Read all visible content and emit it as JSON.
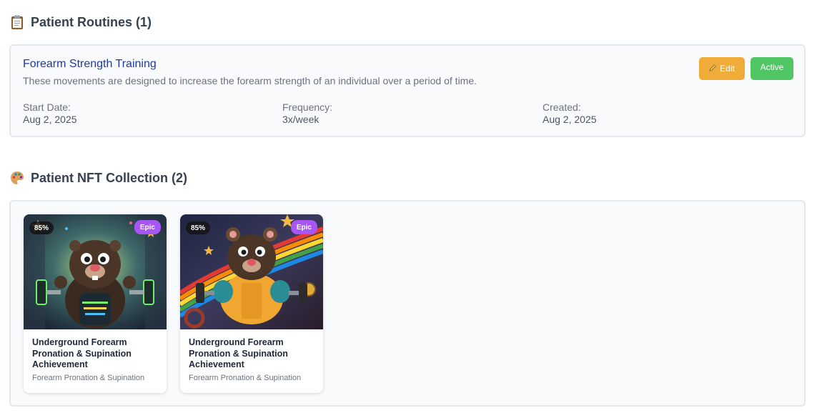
{
  "routines": {
    "section_title": "Patient Routines (1)",
    "section_icon": "clipboard-icon",
    "items": [
      {
        "name": "Forearm Strength Training",
        "description": "These movements are designed to increase the forearm strength of an individual over a period of time.",
        "edit_label": "Edit",
        "edit_icon": "pencil-icon",
        "status": "Active",
        "start_date_label": "Start Date:",
        "start_date": "Aug 2, 2025",
        "frequency_label": "Frequency:",
        "frequency": "3x/week",
        "created_label": "Created:",
        "created": "Aug 2, 2025"
      }
    ]
  },
  "nfts": {
    "section_title": "Patient NFT Collection (2)",
    "section_icon": "palette-icon",
    "items": [
      {
        "percent": "85%",
        "rarity": "Epic",
        "title": "Underground Forearm Pronation & Supination Achievement",
        "category": "Forearm Pronation & Supination"
      },
      {
        "percent": "85%",
        "rarity": "Epic",
        "title": "Underground Forearm Pronation & Supination Achievement",
        "category": "Forearm Pronation & Supination"
      }
    ]
  },
  "colors": {
    "link": "#1e3a9f",
    "edit_button": "#f0ac38",
    "active_badge": "#4fc663",
    "rarity_epic": "#a855f7",
    "card_border": "#e3e7ee"
  }
}
